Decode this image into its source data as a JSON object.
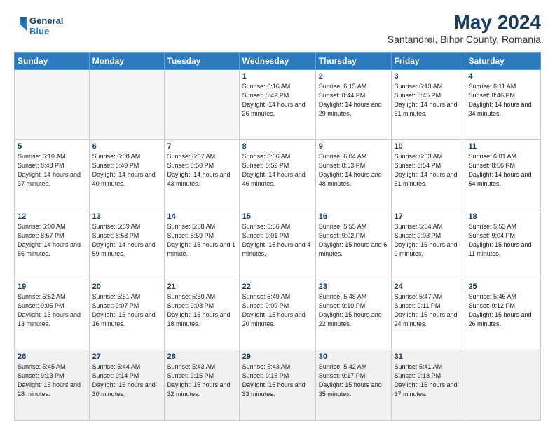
{
  "header": {
    "logo": "GeneralBlue",
    "month_year": "May 2024",
    "location": "Santandrei, Bihor County, Romania"
  },
  "days_of_week": [
    "Sunday",
    "Monday",
    "Tuesday",
    "Wednesday",
    "Thursday",
    "Friday",
    "Saturday"
  ],
  "weeks": [
    [
      {
        "day": "",
        "info": ""
      },
      {
        "day": "",
        "info": ""
      },
      {
        "day": "",
        "info": ""
      },
      {
        "day": "1",
        "info": "Sunrise: 6:16 AM\nSunset: 8:42 PM\nDaylight: 14 hours\nand 26 minutes."
      },
      {
        "day": "2",
        "info": "Sunrise: 6:15 AM\nSunset: 8:44 PM\nDaylight: 14 hours\nand 29 minutes."
      },
      {
        "day": "3",
        "info": "Sunrise: 6:13 AM\nSunset: 8:45 PM\nDaylight: 14 hours\nand 31 minutes."
      },
      {
        "day": "4",
        "info": "Sunrise: 6:11 AM\nSunset: 8:46 PM\nDaylight: 14 hours\nand 34 minutes."
      }
    ],
    [
      {
        "day": "5",
        "info": "Sunrise: 6:10 AM\nSunset: 8:48 PM\nDaylight: 14 hours\nand 37 minutes."
      },
      {
        "day": "6",
        "info": "Sunrise: 6:08 AM\nSunset: 8:49 PM\nDaylight: 14 hours\nand 40 minutes."
      },
      {
        "day": "7",
        "info": "Sunrise: 6:07 AM\nSunset: 8:50 PM\nDaylight: 14 hours\nand 43 minutes."
      },
      {
        "day": "8",
        "info": "Sunrise: 6:06 AM\nSunset: 8:52 PM\nDaylight: 14 hours\nand 46 minutes."
      },
      {
        "day": "9",
        "info": "Sunrise: 6:04 AM\nSunset: 8:53 PM\nDaylight: 14 hours\nand 48 minutes."
      },
      {
        "day": "10",
        "info": "Sunrise: 6:03 AM\nSunset: 8:54 PM\nDaylight: 14 hours\nand 51 minutes."
      },
      {
        "day": "11",
        "info": "Sunrise: 6:01 AM\nSunset: 8:56 PM\nDaylight: 14 hours\nand 54 minutes."
      }
    ],
    [
      {
        "day": "12",
        "info": "Sunrise: 6:00 AM\nSunset: 8:57 PM\nDaylight: 14 hours\nand 56 minutes."
      },
      {
        "day": "13",
        "info": "Sunrise: 5:59 AM\nSunset: 8:58 PM\nDaylight: 14 hours\nand 59 minutes."
      },
      {
        "day": "14",
        "info": "Sunrise: 5:58 AM\nSunset: 8:59 PM\nDaylight: 15 hours\nand 1 minute."
      },
      {
        "day": "15",
        "info": "Sunrise: 5:56 AM\nSunset: 9:01 PM\nDaylight: 15 hours\nand 4 minutes."
      },
      {
        "day": "16",
        "info": "Sunrise: 5:55 AM\nSunset: 9:02 PM\nDaylight: 15 hours\nand 6 minutes."
      },
      {
        "day": "17",
        "info": "Sunrise: 5:54 AM\nSunset: 9:03 PM\nDaylight: 15 hours\nand 9 minutes."
      },
      {
        "day": "18",
        "info": "Sunrise: 5:53 AM\nSunset: 9:04 PM\nDaylight: 15 hours\nand 11 minutes."
      }
    ],
    [
      {
        "day": "19",
        "info": "Sunrise: 5:52 AM\nSunset: 9:05 PM\nDaylight: 15 hours\nand 13 minutes."
      },
      {
        "day": "20",
        "info": "Sunrise: 5:51 AM\nSunset: 9:07 PM\nDaylight: 15 hours\nand 16 minutes."
      },
      {
        "day": "21",
        "info": "Sunrise: 5:50 AM\nSunset: 9:08 PM\nDaylight: 15 hours\nand 18 minutes."
      },
      {
        "day": "22",
        "info": "Sunrise: 5:49 AM\nSunset: 9:09 PM\nDaylight: 15 hours\nand 20 minutes."
      },
      {
        "day": "23",
        "info": "Sunrise: 5:48 AM\nSunset: 9:10 PM\nDaylight: 15 hours\nand 22 minutes."
      },
      {
        "day": "24",
        "info": "Sunrise: 5:47 AM\nSunset: 9:11 PM\nDaylight: 15 hours\nand 24 minutes."
      },
      {
        "day": "25",
        "info": "Sunrise: 5:46 AM\nSunset: 9:12 PM\nDaylight: 15 hours\nand 26 minutes."
      }
    ],
    [
      {
        "day": "26",
        "info": "Sunrise: 5:45 AM\nSunset: 9:13 PM\nDaylight: 15 hours\nand 28 minutes."
      },
      {
        "day": "27",
        "info": "Sunrise: 5:44 AM\nSunset: 9:14 PM\nDaylight: 15 hours\nand 30 minutes."
      },
      {
        "day": "28",
        "info": "Sunrise: 5:43 AM\nSunset: 9:15 PM\nDaylight: 15 hours\nand 32 minutes."
      },
      {
        "day": "29",
        "info": "Sunrise: 5:43 AM\nSunset: 9:16 PM\nDaylight: 15 hours\nand 33 minutes."
      },
      {
        "day": "30",
        "info": "Sunrise: 5:42 AM\nSunset: 9:17 PM\nDaylight: 15 hours\nand 35 minutes."
      },
      {
        "day": "31",
        "info": "Sunrise: 5:41 AM\nSunset: 9:18 PM\nDaylight: 15 hours\nand 37 minutes."
      },
      {
        "day": "",
        "info": ""
      }
    ]
  ]
}
